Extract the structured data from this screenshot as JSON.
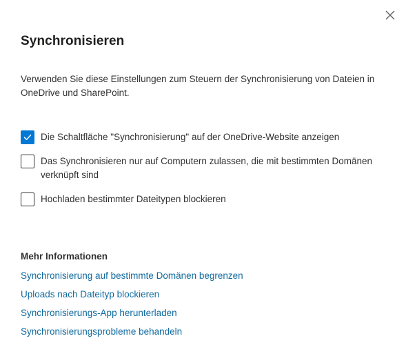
{
  "panel": {
    "title": "Synchronisieren",
    "description": "Verwenden Sie diese Einstellungen zum Steuern der Synchronisierung von Dateien in OneDrive und SharePoint."
  },
  "options": [
    {
      "label": "Die Schaltfläche \"Synchronisierung\" auf der OneDrive-Website anzeigen",
      "checked": true
    },
    {
      "label": "Das Synchronisieren nur auf Computern zulassen, die mit bestimmten Domänen verknüpft sind",
      "checked": false
    },
    {
      "label": "Hochladen bestimmter Dateitypen blockieren",
      "checked": false
    }
  ],
  "more_info": {
    "heading": "Mehr Informationen",
    "links": [
      "Synchronisierung auf bestimmte Domänen begrenzen",
      "Uploads nach Dateityp blockieren",
      "Synchronisierungs-App herunterladen",
      "Synchronisierungsprobleme behandeln"
    ]
  },
  "colors": {
    "accent": "#0078d4",
    "link": "#0f6a9e",
    "text": "#323130"
  },
  "icons": {
    "close": "close-icon",
    "check": "checkmark-icon"
  }
}
